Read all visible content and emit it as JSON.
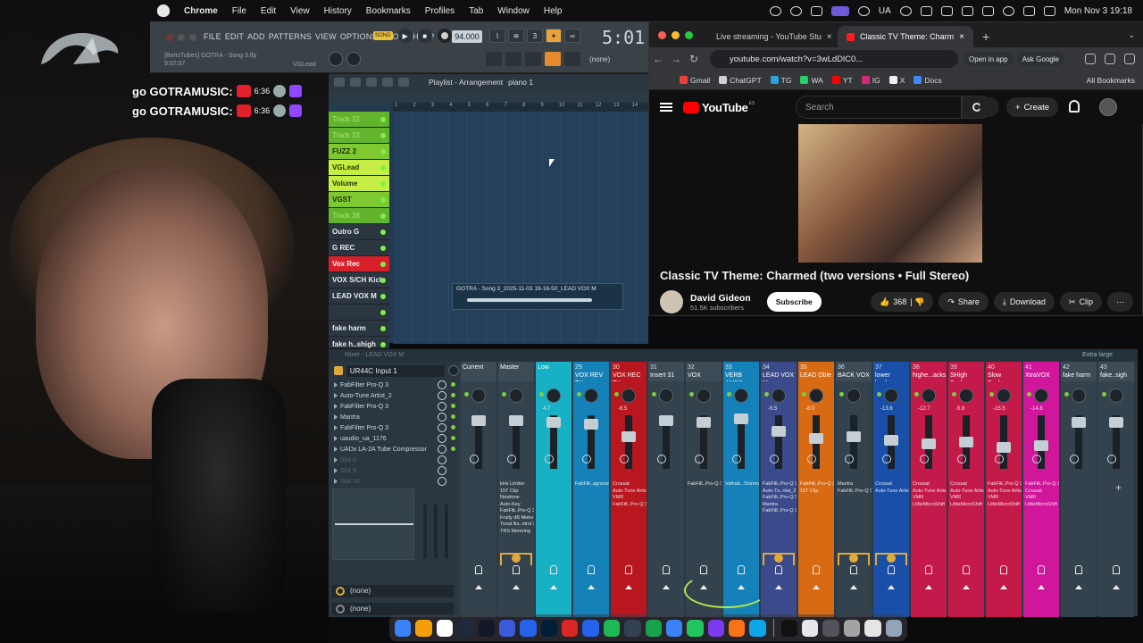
{
  "menubar": {
    "app": "Chrome",
    "items": [
      "File",
      "Edit",
      "View",
      "History",
      "Bookmarks",
      "Profiles",
      "Tab",
      "Window",
      "Help"
    ],
    "lang": "UA",
    "clock": "Mon Nov 3  19:18"
  },
  "stream": {
    "lines": [
      {
        "text": "go GOTRAMUSIC:",
        "count": "6:36"
      },
      {
        "text": "go GOTRAMUSIC:",
        "count": "6:36"
      }
    ]
  },
  "fl": {
    "menu": [
      "FILE",
      "EDIT",
      "ADD",
      "PATTERNS",
      "VIEW",
      "OPTIONS",
      "TOOLS",
      "HELP"
    ],
    "hint_file": "[BorisTubes] GOTRA - Song 3.flp",
    "hint_time": "9:07:07",
    "hint_track": "VGLead",
    "song_label": "SONG",
    "tempo": "94.000",
    "big_time": "5:01",
    "snap": "(none)",
    "playlist_title": "Playlist - Arrangement",
    "playlist_pattern": "piano 1",
    "ruler": [
      "1",
      "2",
      "3",
      "4",
      "5",
      "6",
      "7",
      "8",
      "9",
      "10",
      "11",
      "12",
      "13",
      "14"
    ],
    "tracks": [
      {
        "label": "Track 32",
        "style": "gl"
      },
      {
        "label": "Track 33",
        "style": "gl"
      },
      {
        "label": "FUZZ 2",
        "style": "g"
      },
      {
        "label": "VGLead",
        "style": "y"
      },
      {
        "label": "Volume",
        "style": "y"
      },
      {
        "label": "VGST",
        "style": "g"
      },
      {
        "label": "Track 38",
        "style": "gl"
      },
      {
        "label": "Outro G",
        "style": "d"
      },
      {
        "label": "G REC",
        "style": "d"
      },
      {
        "label": "Vox Rec",
        "style": "r"
      },
      {
        "label": "VOX S/CH Kick",
        "style": "d"
      },
      {
        "label": "LEAD VOX M",
        "style": "d"
      },
      {
        "label": "",
        "style": "d"
      },
      {
        "label": "fake harm",
        "style": "d"
      },
      {
        "label": "fake h..shigh",
        "style": "d"
      }
    ],
    "clip_label": "GOTRA - Song 3_2025-11-03 19-16-50_LEAD VOX M"
  },
  "browser": {
    "tabs": [
      {
        "title": "Live streaming - YouTube Stu"
      },
      {
        "title": "Classic TV Theme: Charm"
      }
    ],
    "url": "youtube.com/watch?v=3wLdDlC0...",
    "open_in_app": "Open in app",
    "ask_google": "Ask Google",
    "bookmarks": [
      "Gmail",
      "ChatGPT",
      "TG",
      "WA",
      "YT",
      "IG",
      "X",
      "Docs"
    ],
    "all_bookmarks": "All Bookmarks"
  },
  "youtube": {
    "brand": "YouTube",
    "region": "ES",
    "search_placeholder": "Search",
    "create": "Create",
    "video_title": "Classic TV Theme: Charmed (two versions • Full Stereo)",
    "channel": "David Gideon",
    "subscribers": "51.5K subscribers",
    "subscribe": "Subscribe",
    "likes": "368",
    "share": "Share",
    "download": "Download",
    "clip": "Clip",
    "more": "⋯"
  },
  "mixer": {
    "title": "Mixer - LEAD VOX M",
    "layout": "Extra large",
    "input": "UR44C Input 1",
    "slots": [
      {
        "name": "FabFilter Pro-Q 3",
        "on": true
      },
      {
        "name": "Auto-Tune Artist_2",
        "on": true
      },
      {
        "name": "FabFilter Pro-Q 3",
        "on": true
      },
      {
        "name": "Mantra",
        "on": true
      },
      {
        "name": "FabFilter Pro-Q 3",
        "on": true
      },
      {
        "name": "uaudio_ua_1176",
        "on": true
      },
      {
        "name": "UADx LA-2A Tube Compressor",
        "on": true
      },
      {
        "name": "Slot 8",
        "on": false
      },
      {
        "name": "Slot 9",
        "on": false
      },
      {
        "name": "Slot 10",
        "on": false
      }
    ],
    "bottom1": "(none)",
    "bottom2": "(none)",
    "strips": [
      {
        "num": "",
        "name": "Current",
        "color": "#3c4b55",
        "val": "",
        "fx": ""
      },
      {
        "num": "",
        "name": "Master",
        "sub": "Master",
        "color": "#3c4b55",
        "val": "",
        "fx": "kHs Limiter\n15T Clip\nNewtone\nAuto-Key\nFabFilt..Pro-Q 3\nFruity dB Meter\nTonal Ba..ntrol 2\nTRS Metering"
      },
      {
        "num": "",
        "name": "Low",
        "color": "#17b0c4",
        "val": "4.7",
        "fx": ""
      },
      {
        "num": "29",
        "name": "VOX REV TY",
        "color": "#1482b8",
        "val": "",
        "fx": "FabFilt..agressive"
      },
      {
        "num": "30",
        "name": "VOX REC TY",
        "color": "#b8171f",
        "val": "-6.5",
        "fx": "Crossat\nAuto-Tune Artist\nVMR\nFabFilt..Pro-Q 3"
      },
      {
        "num": "31",
        "name": "Insert 31",
        "color": "#3c4b55",
        "val": "",
        "fx": ""
      },
      {
        "num": "32",
        "name": "VOX",
        "color": "#3c4b55",
        "val": "",
        "fx": "FabFilt..Pro-Q 3"
      },
      {
        "num": "33",
        "name": "VERB AMBS",
        "color": "#1482b8",
        "val": "",
        "fx": "ValhalL..Shimmer"
      },
      {
        "num": "34",
        "name": "LEAD VOX M",
        "color": "#3a4a8a",
        "val": "-5.5",
        "fx": "FabFilt..Pro-Q 3\nAuto-Tu..rtist_2\nFabFilt..Pro-Q 3\nMantra\nFabFilt..Pro-Q 3"
      },
      {
        "num": "35",
        "name": "LEAD Oble",
        "color": "#d86a14",
        "val": "-8.0",
        "fx": "FabFilt..Pro-Q 3\n15T Clip"
      },
      {
        "num": "36",
        "name": "BACK VOX",
        "color": "#3c4b55",
        "val": "",
        "fx": "Mantra\nFabFilt..Pro-Q 3"
      },
      {
        "num": "37",
        "name": "lower backs",
        "color": "#1a4fa8",
        "val": "-13.6",
        "fx": "Crossat\nAuto-Tune Artist"
      },
      {
        "num": "38",
        "name": "highe...acks",
        "color": "#c41a4a",
        "val": "-12.7",
        "fx": "Crossat\nAuto-Tune Artist\nVMR\nLittleMicroShift"
      },
      {
        "num": "39",
        "name": "SHigh Backs",
        "color": "#c41a4a",
        "val": "-5.8",
        "fx": "Crossat\nAuto-Tune Artist\nVMR\nLittleMicroShift"
      },
      {
        "num": "40",
        "name": "Slow Backs",
        "color": "#c41a4a",
        "val": "-15.5",
        "fx": "FabFilt..Pro-Q 3\nAuto-Tune Artist\nVMR\nLittleMicroShift"
      },
      {
        "num": "41",
        "name": "XtraVOX",
        "color": "#d0179c",
        "val": "-14.8",
        "fx": "FabFilt..Pro-Q 3\nCrossat\nVMR\nLittleMicroShift"
      },
      {
        "num": "42",
        "name": "fake harm",
        "color": "#3c4b55",
        "val": "",
        "fx": ""
      },
      {
        "num": "43",
        "name": "fake..sigh",
        "color": "#3c4b55",
        "val": "",
        "fx": ""
      }
    ]
  },
  "dock": {
    "colors": [
      "#3b82f6",
      "#f59e0b",
      "#ffffff",
      "#1e293b",
      "#111827",
      "#3b5bdb",
      "#2563eb",
      "#001e36",
      "#dc2626",
      "#2563eb",
      "#1db954",
      "#334155",
      "#16a34a",
      "#3b82f6",
      "#22c55e",
      "#7c3aed",
      "#f97316",
      "#0ea5e9",
      "#111",
      "#e5e7eb",
      "#52525b",
      "#a3a3a3",
      "#e5e5e5",
      "#94a3b8"
    ]
  }
}
